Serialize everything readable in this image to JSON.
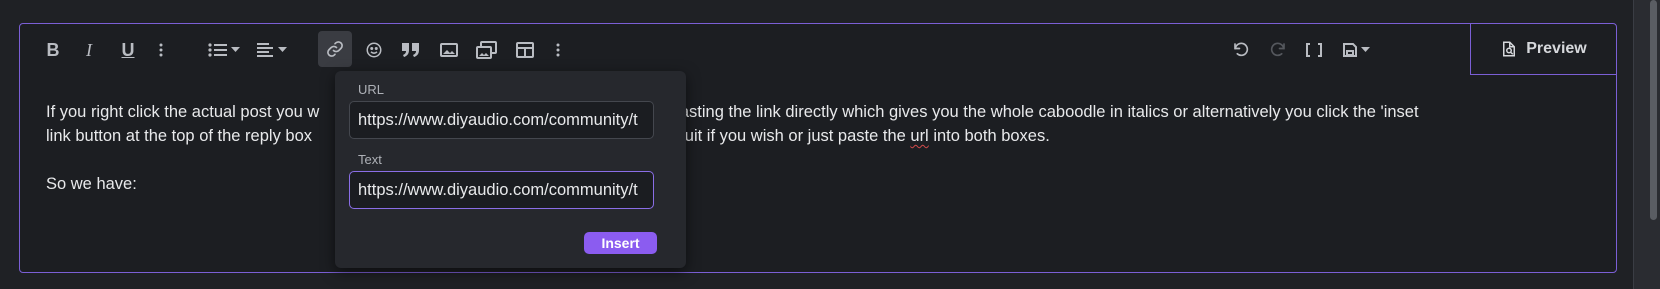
{
  "toolbar": {
    "left_tools": [
      {
        "name": "bold-icon",
        "glyph": "B"
      },
      {
        "name": "italic-icon",
        "glyph": "I"
      },
      {
        "name": "underline-icon",
        "glyph": "U"
      },
      {
        "name": "more-text-options-icon"
      },
      {
        "name": "list-icon"
      },
      {
        "name": "align-icon"
      },
      {
        "name": "link-icon"
      },
      {
        "name": "smilie-icon"
      },
      {
        "name": "quote-icon"
      },
      {
        "name": "image-icon"
      },
      {
        "name": "media-icon"
      },
      {
        "name": "table-icon"
      },
      {
        "name": "more-insert-options-icon"
      }
    ],
    "right_tools": [
      {
        "name": "undo-icon"
      },
      {
        "name": "redo-icon"
      },
      {
        "name": "bbcode-toggle-icon"
      },
      {
        "name": "drafts-icon"
      }
    ],
    "preview_label": "Preview"
  },
  "content": {
    "paragraph_1_before": "If you right click the actual post you w",
    "paragraph_1_mid_a": "a choice of pasting the link directly which gives you the whole caboodle in italics or alternatively you click the 'inset",
    "paragraph_1_line2_a": "link button at the top of the reply box",
    "paragraph_1_line2_b": "t to suit if you wish or just paste the ",
    "misspelled_word": "url",
    "paragraph_1_line2_c": " into both boxes.",
    "paragraph_2": "So we have:"
  },
  "link_popup": {
    "url_label": "URL",
    "url_value": "https://www.diyaudio.com/community/t",
    "text_label": "Text",
    "text_value": "https://www.diyaudio.com/community/t",
    "insert_label": "Insert"
  },
  "colors": {
    "accent": "#8b5cf0",
    "editor_border": "#7b5fd6",
    "background": "#1c1e22"
  }
}
